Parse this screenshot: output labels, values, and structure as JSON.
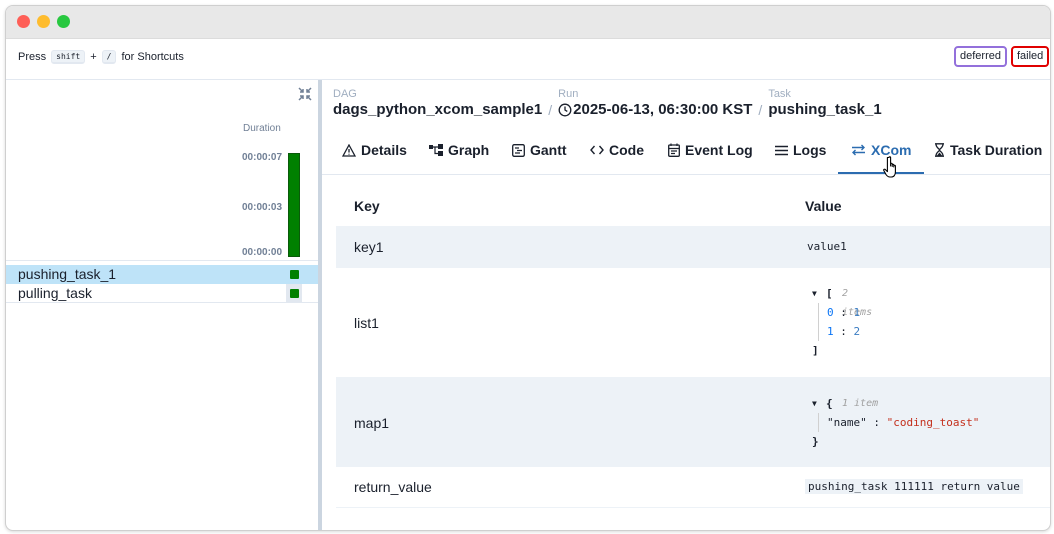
{
  "shortcuts": {
    "press": "Press",
    "key1": "shift",
    "plus": "+",
    "key2": "/",
    "suffix": "for Shortcuts"
  },
  "badges": {
    "deferred": "deferred",
    "failed": "failed"
  },
  "grid": {
    "duration_title": "Duration",
    "duration_ticks": [
      "00:00:07",
      "00:00:03",
      "00:00:00"
    ],
    "tasks": [
      {
        "name": "pushing_task_1",
        "selected": true,
        "status_color": "#008000"
      },
      {
        "name": "pulling_task",
        "selected": false,
        "status_color": "#008000"
      }
    ]
  },
  "breadcrumb": {
    "dag_label": "DAG",
    "dag_value": "dags_python_xcom_sample1",
    "run_label": "Run",
    "run_value": "2025-06-13, 06:30:00 KST",
    "task_label": "Task",
    "task_value": "pushing_task_1",
    "separator": "/"
  },
  "tabs": [
    {
      "label": "Details",
      "icon": "warning-triangle-icon"
    },
    {
      "label": "Graph",
      "icon": "graph-icon"
    },
    {
      "label": "Gantt",
      "icon": "gantt-icon"
    },
    {
      "label": "Code",
      "icon": "code-icon"
    },
    {
      "label": "Event Log",
      "icon": "calendar-icon"
    },
    {
      "label": "Logs",
      "icon": "list-icon"
    },
    {
      "label": "XCom",
      "icon": "arrows-exchange-icon",
      "active": true
    },
    {
      "label": "Task Duration",
      "icon": "hourglass-icon"
    }
  ],
  "xcom": {
    "header_key": "Key",
    "header_value": "Value",
    "rows": {
      "key1": {
        "key": "key1",
        "value": "value1"
      },
      "list1": {
        "key": "list1",
        "open": "[",
        "meta": "2 items",
        "items": [
          {
            "idx": "0",
            "val": "1"
          },
          {
            "idx": "1",
            "val": "2"
          }
        ],
        "sep": ":",
        "close": "]"
      },
      "map1": {
        "key": "map1",
        "open": "{",
        "meta": "1 item",
        "entry_key": "\"name\"",
        "sep": ":",
        "entry_val": "\"coding_toast\"",
        "close": "}"
      },
      "return_value": {
        "key": "return_value",
        "value": "pushing_task 111111 return value"
      }
    }
  },
  "colors": {
    "accent": "#2b6cb0",
    "success": "#008000",
    "deferred": "#9370db",
    "failed": "#e00000"
  }
}
